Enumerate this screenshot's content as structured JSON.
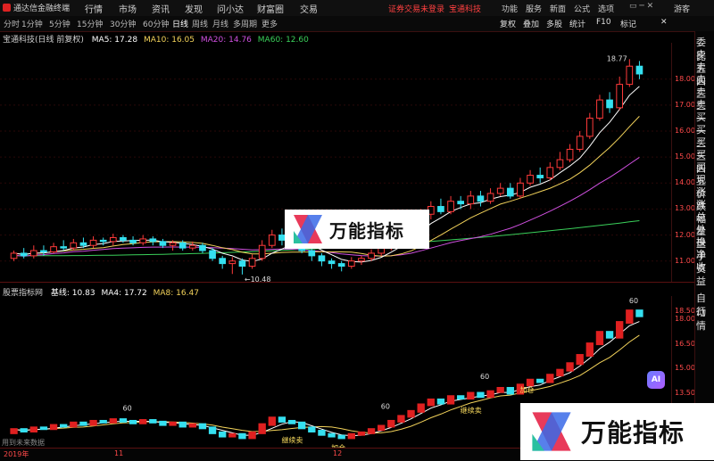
{
  "app": {
    "title": "通达信金融终端",
    "menu": [
      "行情",
      "市场",
      "资讯",
      "发现",
      "问小达",
      "财富圈",
      "交易"
    ],
    "status_notice": "证券交易未登录",
    "stock_name": "宝通科技",
    "right_menu": [
      "功能",
      "服务",
      "新面",
      "公式",
      "选项",
      "游客"
    ]
  },
  "tabs": [
    "分时",
    "1分钟",
    "5分钟",
    "15分钟",
    "30分钟",
    "60分钟",
    "日线",
    "周线",
    "月线",
    "多周期",
    "更多"
  ],
  "active_tab": "日线",
  "toolbar": [
    "复权",
    "叠加",
    "多股",
    "统计",
    "F10",
    "标记"
  ],
  "main_legend": {
    "title": "宝通科技(日线 前复权)",
    "ma5": "MA5: 17.28",
    "ma10": "MA10: 16.05",
    "ma20": "MA20: 14.76",
    "ma60": "MA60: 12.60"
  },
  "sub_legend": {
    "title": "股票指标网",
    "base": "基线: 10.83",
    "ma4": "MA4: 17.72",
    "ma8": "MA8: 16.47"
  },
  "annotations": {
    "high": "18.77",
    "low": "10.48",
    "sig1": "60",
    "sig2": "60",
    "sig3": "60",
    "sig4": "60",
    "sell1": "继续卖",
    "sell2": "继续卖",
    "buy1": "加仓",
    "buy2": "加仓"
  },
  "bottom": {
    "note": "用到未来数据",
    "date1": "2019年",
    "date2": "11",
    "date3": "12"
  },
  "sidebar": [
    "委比",
    "卖五",
    "卖四",
    "卖三",
    "卖二",
    "卖一",
    "买一",
    "买二",
    "买三",
    "买四",
    "买五",
    "现价",
    "涨跌",
    "涨幅",
    "总量",
    "外盘",
    "换手",
    "净资",
    "收益"
  ],
  "sidebar_lower": [
    "自动",
    "行情"
  ],
  "right_price_axis": [
    "18.00",
    "17.00",
    "16.00",
    "15.00",
    "14.00",
    "13.00",
    "12.00",
    "11.00"
  ],
  "right_sub_axis": [
    "18.50",
    "18.00",
    "16.50",
    "15.00",
    "13.50"
  ],
  "watermark": "万能指标",
  "ai_label": "AI",
  "colors": {
    "up": "#ff3a3a",
    "down": "#35e0f0",
    "ma5": "#ffffff",
    "ma10": "#f2d25a",
    "ma20": "#d050e0",
    "ma60": "#3ad05a"
  },
  "chart_data": {
    "type": "candlestick",
    "values_note": "daily candles (open, close, high, low) read approximately from the chart",
    "candles": [
      [
        11.1,
        11.3,
        11.4,
        11.0
      ],
      [
        11.3,
        11.2,
        11.5,
        11.1
      ],
      [
        11.2,
        11.4,
        11.6,
        11.1
      ],
      [
        11.4,
        11.35,
        11.6,
        11.2
      ],
      [
        11.35,
        11.55,
        11.7,
        11.3
      ],
      [
        11.55,
        11.5,
        11.8,
        11.4
      ],
      [
        11.5,
        11.7,
        11.85,
        11.4
      ],
      [
        11.7,
        11.6,
        11.9,
        11.5
      ],
      [
        11.6,
        11.8,
        11.95,
        11.5
      ],
      [
        11.8,
        11.75,
        11.9,
        11.6
      ],
      [
        11.75,
        11.9,
        12.05,
        11.6
      ],
      [
        11.9,
        11.8,
        12.0,
        11.7
      ],
      [
        11.8,
        11.7,
        11.95,
        11.6
      ],
      [
        11.7,
        11.85,
        12.0,
        11.6
      ],
      [
        11.85,
        11.75,
        11.95,
        11.6
      ],
      [
        11.75,
        11.6,
        11.85,
        11.5
      ],
      [
        11.6,
        11.7,
        11.8,
        11.4
      ],
      [
        11.7,
        11.5,
        11.8,
        11.4
      ],
      [
        11.5,
        11.6,
        11.75,
        11.4
      ],
      [
        11.6,
        11.4,
        11.7,
        11.3
      ],
      [
        11.4,
        11.1,
        11.5,
        11.0
      ],
      [
        11.1,
        10.9,
        11.2,
        10.7
      ],
      [
        10.9,
        11.0,
        11.15,
        10.5
      ],
      [
        11.0,
        10.8,
        11.1,
        10.48
      ],
      [
        10.8,
        11.1,
        11.25,
        10.7
      ],
      [
        11.1,
        11.6,
        11.8,
        11.0
      ],
      [
        11.6,
        12.0,
        12.2,
        11.5
      ],
      [
        12.0,
        11.8,
        12.25,
        11.6
      ],
      [
        11.8,
        11.7,
        12.0,
        11.5
      ],
      [
        11.7,
        11.4,
        11.85,
        11.3
      ],
      [
        11.4,
        11.2,
        11.55,
        11.0
      ],
      [
        11.2,
        11.0,
        11.3,
        10.8
      ],
      [
        11.0,
        10.9,
        11.1,
        10.7
      ],
      [
        10.9,
        10.8,
        11.0,
        10.6
      ],
      [
        10.8,
        11.0,
        11.15,
        10.7
      ],
      [
        11.0,
        11.1,
        11.2,
        10.85
      ],
      [
        11.1,
        11.3,
        11.45,
        11.0
      ],
      [
        11.3,
        11.5,
        11.65,
        11.2
      ],
      [
        11.5,
        11.8,
        12.0,
        11.4
      ],
      [
        11.8,
        12.1,
        12.3,
        11.7
      ],
      [
        12.1,
        12.4,
        12.6,
        12.0
      ],
      [
        12.4,
        12.8,
        13.0,
        12.3
      ],
      [
        12.8,
        13.1,
        13.3,
        12.6
      ],
      [
        13.1,
        12.9,
        13.4,
        12.8
      ],
      [
        12.9,
        13.3,
        13.5,
        12.8
      ],
      [
        13.3,
        13.2,
        13.5,
        13.0
      ],
      [
        13.2,
        13.5,
        13.7,
        13.0
      ],
      [
        13.5,
        13.3,
        13.7,
        13.1
      ],
      [
        13.3,
        13.6,
        13.8,
        13.2
      ],
      [
        13.6,
        13.8,
        14.0,
        13.5
      ],
      [
        13.8,
        13.5,
        14.0,
        13.4
      ],
      [
        13.5,
        14.0,
        14.2,
        13.4
      ],
      [
        14.0,
        14.3,
        14.5,
        13.9
      ],
      [
        14.3,
        14.2,
        14.6,
        14.0
      ],
      [
        14.2,
        14.6,
        14.8,
        14.1
      ],
      [
        14.6,
        14.9,
        15.2,
        14.5
      ],
      [
        14.9,
        15.3,
        15.5,
        14.8
      ],
      [
        15.3,
        15.8,
        16.0,
        15.2
      ],
      [
        15.8,
        16.5,
        16.7,
        15.7
      ],
      [
        16.5,
        17.2,
        17.4,
        16.4
      ],
      [
        17.2,
        16.9,
        17.5,
        16.7
      ],
      [
        16.9,
        17.8,
        18.1,
        16.8
      ],
      [
        17.8,
        18.5,
        18.77,
        17.7
      ],
      [
        18.5,
        18.2,
        18.7,
        18.0
      ]
    ],
    "ma_series": [
      {
        "name": "MA5",
        "last": 17.28
      },
      {
        "name": "MA10",
        "last": 16.05
      },
      {
        "name": "MA20",
        "last": 14.76
      },
      {
        "name": "MA60",
        "last": 12.6
      }
    ],
    "ylim": [
      10.2,
      19.4
    ]
  }
}
